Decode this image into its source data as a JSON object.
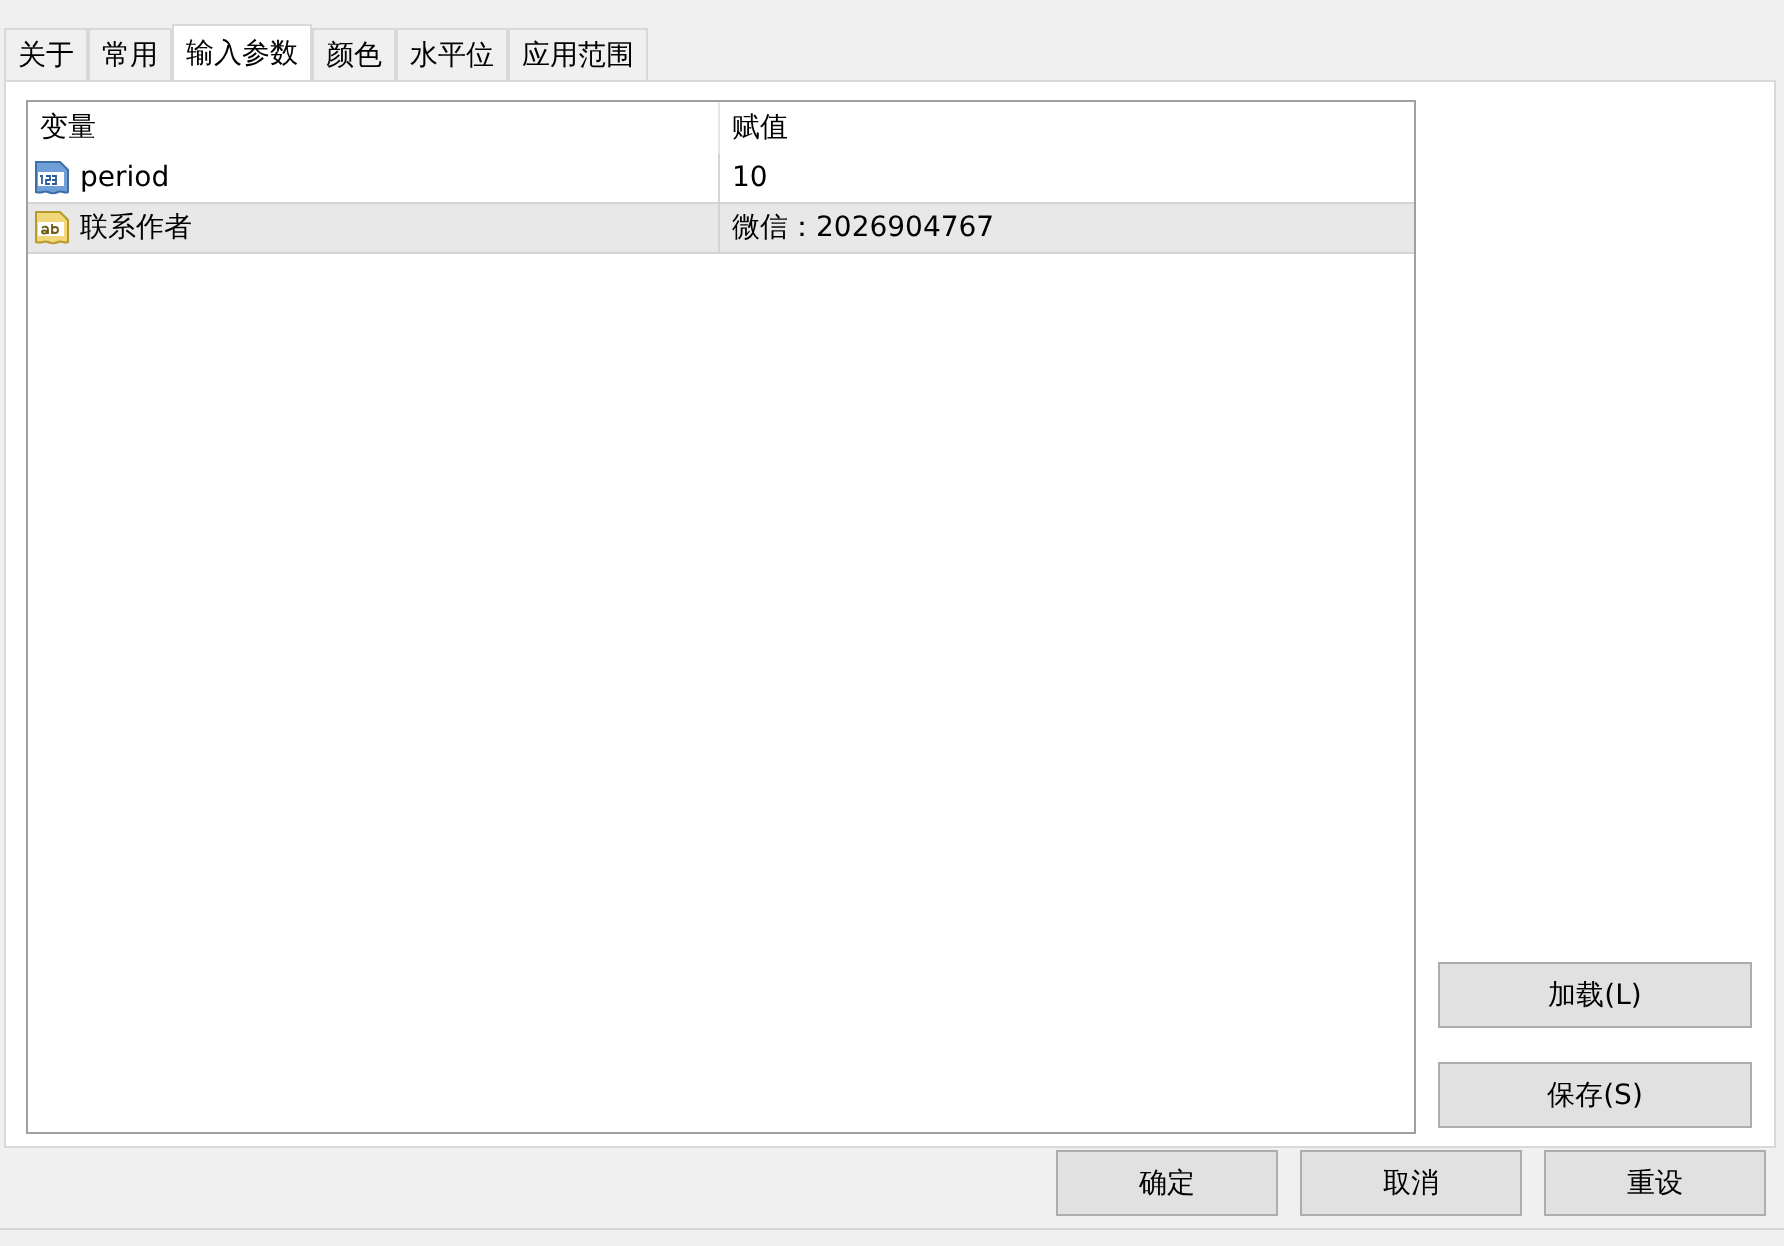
{
  "tabs": [
    {
      "label": "关于",
      "selected": false
    },
    {
      "label": "常用",
      "selected": false
    },
    {
      "label": "输入参数",
      "selected": true
    },
    {
      "label": "颜色",
      "selected": false
    },
    {
      "label": "水平位",
      "selected": false
    },
    {
      "label": "应用范围",
      "selected": false
    }
  ],
  "table": {
    "columns": [
      "变量",
      "赋值"
    ],
    "rows": [
      {
        "kind": "number",
        "name": "period",
        "value": "10",
        "selected": false
      },
      {
        "kind": "text",
        "name": "联系作者",
        "value": "微信：2026904767",
        "selected": true
      }
    ]
  },
  "side_buttons": [
    "加载(L)",
    "保存(S)"
  ],
  "buttons": [
    "确定",
    "取消",
    "重设"
  ]
}
